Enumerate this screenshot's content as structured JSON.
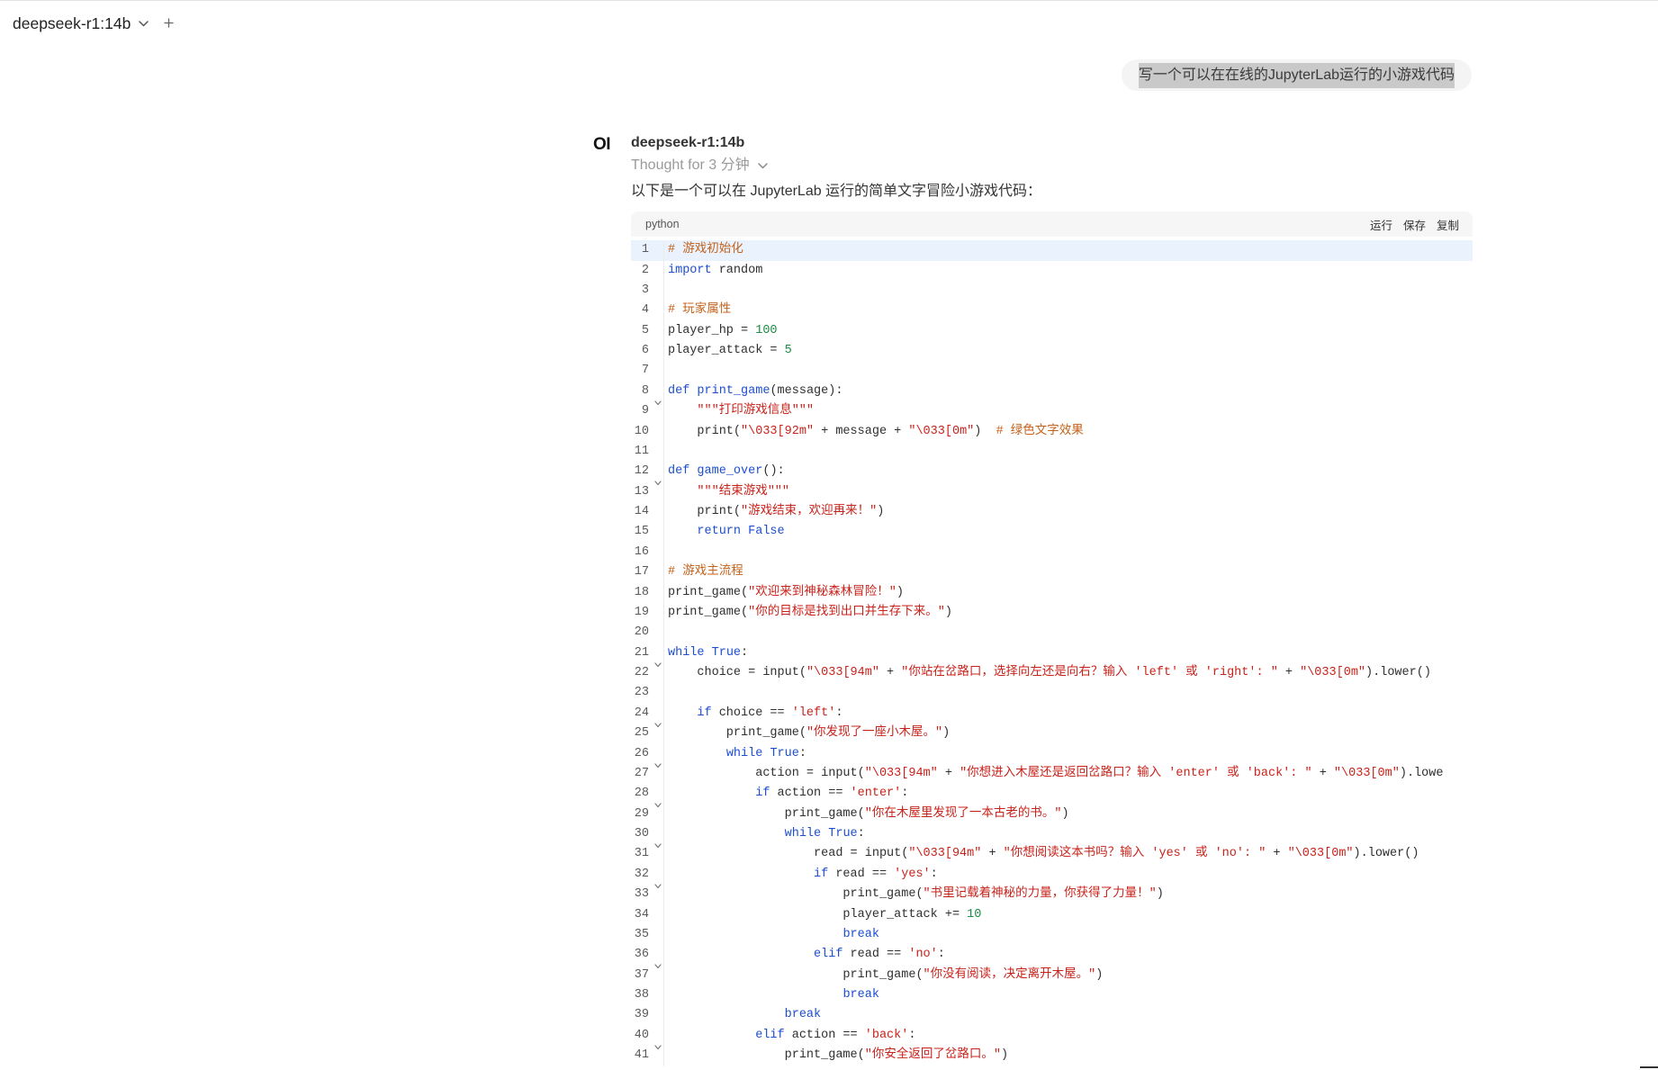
{
  "top_bar": {
    "model_name": "deepseek-r1:14b"
  },
  "user_message": {
    "text": "写一个可以在在线的JupyterLab运行的小游戏代码"
  },
  "assistant": {
    "avatar_text": "OI",
    "model_name": "deepseek-r1:14b",
    "thought_label": "Thought for 3 分钟",
    "intro": "以下是一个可以在 JupyterLab 运行的简单文字冒险小游戏代码："
  },
  "icons": {
    "model_dropdown": "chevron-down-icon",
    "add_model": "plus-icon",
    "thought_toggle": "chevron-down-icon",
    "fold": "chevron-down-icon"
  },
  "syntax_colors": {
    "plain": "#2f2f2f",
    "keyword": "#1d4ed0",
    "comment": "#c4621c",
    "string": "#c8231b",
    "number": "#1f8a45",
    "function": "#1d4ed0"
  },
  "code_block": {
    "language": "python",
    "actions": {
      "run": "运行",
      "save": "保存",
      "copy": "复制"
    },
    "active_line": 1,
    "lines": [
      {
        "num": "1",
        "tokens": [
          {
            "c": "# 游戏初始化"
          }
        ]
      },
      {
        "num": "2",
        "tokens": [
          {
            "k": "import"
          },
          {
            "p": " random"
          }
        ]
      },
      {
        "num": "3",
        "tokens": []
      },
      {
        "num": "4",
        "tokens": [
          {
            "c": "# 玩家属性"
          }
        ]
      },
      {
        "num": "5",
        "tokens": [
          {
            "p": "player_hp = "
          },
          {
            "d": "100"
          }
        ]
      },
      {
        "num": "6",
        "tokens": [
          {
            "p": "player_attack = "
          },
          {
            "d": "5"
          }
        ]
      },
      {
        "num": "7",
        "tokens": []
      },
      {
        "num": "8",
        "fold": true,
        "tokens": [
          {
            "k": "def"
          },
          {
            "p": " "
          },
          {
            "f": "print_game"
          },
          {
            "p": "(message):"
          }
        ]
      },
      {
        "num": "9",
        "tokens": [
          {
            "p": "    "
          },
          {
            "s": "\"\"\"打印游戏信息\"\"\""
          }
        ]
      },
      {
        "num": "10",
        "tokens": [
          {
            "p": "    print("
          },
          {
            "s": "\"\\033[92m\""
          },
          {
            "p": " + message + "
          },
          {
            "s": "\"\\033[0m\""
          },
          {
            "p": ")  "
          },
          {
            "c": "# 绿色文字效果"
          }
        ]
      },
      {
        "num": "11",
        "tokens": []
      },
      {
        "num": "12",
        "fold": true,
        "tokens": [
          {
            "k": "def"
          },
          {
            "p": " "
          },
          {
            "f": "game_over"
          },
          {
            "p": "():"
          }
        ]
      },
      {
        "num": "13",
        "tokens": [
          {
            "p": "    "
          },
          {
            "s": "\"\"\"结束游戏\"\"\""
          }
        ]
      },
      {
        "num": "14",
        "tokens": [
          {
            "p": "    print("
          },
          {
            "s": "\"游戏结束，欢迎再来！\""
          },
          {
            "p": ")"
          }
        ]
      },
      {
        "num": "15",
        "tokens": [
          {
            "p": "    "
          },
          {
            "k": "return"
          },
          {
            "p": " "
          },
          {
            "k": "False"
          }
        ]
      },
      {
        "num": "16",
        "tokens": []
      },
      {
        "num": "17",
        "tokens": [
          {
            "c": "# 游戏主流程"
          }
        ]
      },
      {
        "num": "18",
        "tokens": [
          {
            "p": "print_game("
          },
          {
            "s": "\"欢迎来到神秘森林冒险！\""
          },
          {
            "p": ")"
          }
        ]
      },
      {
        "num": "19",
        "tokens": [
          {
            "p": "print_game("
          },
          {
            "s": "\"你的目标是找到出口并生存下来。\""
          },
          {
            "p": ")"
          }
        ]
      },
      {
        "num": "20",
        "tokens": []
      },
      {
        "num": "21",
        "fold": true,
        "tokens": [
          {
            "k": "while"
          },
          {
            "p": " "
          },
          {
            "k": "True"
          },
          {
            "p": ":"
          }
        ]
      },
      {
        "num": "22",
        "tokens": [
          {
            "p": "    choice = input("
          },
          {
            "s": "\"\\033[94m\""
          },
          {
            "p": " + "
          },
          {
            "s": "\"你站在岔路口，选择向左还是向右？输入 'left' 或 'right': \""
          },
          {
            "p": " + "
          },
          {
            "s": "\"\\033[0m\""
          },
          {
            "p": ").lower()"
          }
        ]
      },
      {
        "num": "23",
        "tokens": []
      },
      {
        "num": "24",
        "fold": true,
        "tokens": [
          {
            "p": "    "
          },
          {
            "k": "if"
          },
          {
            "p": " choice == "
          },
          {
            "s": "'left'"
          },
          {
            "p": ":"
          }
        ]
      },
      {
        "num": "25",
        "tokens": [
          {
            "p": "        print_game("
          },
          {
            "s": "\"你发现了一座小木屋。\""
          },
          {
            "p": ")"
          }
        ]
      },
      {
        "num": "26",
        "fold": true,
        "tokens": [
          {
            "p": "        "
          },
          {
            "k": "while"
          },
          {
            "p": " "
          },
          {
            "k": "True"
          },
          {
            "p": ":"
          }
        ]
      },
      {
        "num": "27",
        "tokens": [
          {
            "p": "            action = input("
          },
          {
            "s": "\"\\033[94m\""
          },
          {
            "p": " + "
          },
          {
            "s": "\"你想进入木屋还是返回岔路口？输入 'enter' 或 'back': \""
          },
          {
            "p": " + "
          },
          {
            "s": "\"\\033[0m\""
          },
          {
            "p": ").lowe"
          }
        ]
      },
      {
        "num": "28",
        "fold": true,
        "tokens": [
          {
            "p": "            "
          },
          {
            "k": "if"
          },
          {
            "p": " action == "
          },
          {
            "s": "'enter'"
          },
          {
            "p": ":"
          }
        ]
      },
      {
        "num": "29",
        "tokens": [
          {
            "p": "                print_game("
          },
          {
            "s": "\"你在木屋里发现了一本古老的书。\""
          },
          {
            "p": ")"
          }
        ]
      },
      {
        "num": "30",
        "fold": true,
        "tokens": [
          {
            "p": "                "
          },
          {
            "k": "while"
          },
          {
            "p": " "
          },
          {
            "k": "True"
          },
          {
            "p": ":"
          }
        ]
      },
      {
        "num": "31",
        "tokens": [
          {
            "p": "                    read = input("
          },
          {
            "s": "\"\\033[94m\""
          },
          {
            "p": " + "
          },
          {
            "s": "\"你想阅读这本书吗？输入 'yes' 或 'no': \""
          },
          {
            "p": " + "
          },
          {
            "s": "\"\\033[0m\""
          },
          {
            "p": ").lower()"
          }
        ]
      },
      {
        "num": "32",
        "fold": true,
        "tokens": [
          {
            "p": "                    "
          },
          {
            "k": "if"
          },
          {
            "p": " read == "
          },
          {
            "s": "'yes'"
          },
          {
            "p": ":"
          }
        ]
      },
      {
        "num": "33",
        "tokens": [
          {
            "p": "                        print_game("
          },
          {
            "s": "\"书里记载着神秘的力量，你获得了力量！\""
          },
          {
            "p": ")"
          }
        ]
      },
      {
        "num": "34",
        "tokens": [
          {
            "p": "                        player_attack += "
          },
          {
            "d": "10"
          }
        ]
      },
      {
        "num": "35",
        "tokens": [
          {
            "p": "                        "
          },
          {
            "k": "break"
          }
        ]
      },
      {
        "num": "36",
        "fold": true,
        "tokens": [
          {
            "p": "                    "
          },
          {
            "k": "elif"
          },
          {
            "p": " read == "
          },
          {
            "s": "'no'"
          },
          {
            "p": ":"
          }
        ]
      },
      {
        "num": "37",
        "tokens": [
          {
            "p": "                        print_game("
          },
          {
            "s": "\"你没有阅读，决定离开木屋。\""
          },
          {
            "p": ")"
          }
        ]
      },
      {
        "num": "38",
        "tokens": [
          {
            "p": "                        "
          },
          {
            "k": "break"
          }
        ]
      },
      {
        "num": "39",
        "tokens": [
          {
            "p": "                "
          },
          {
            "k": "break"
          }
        ]
      },
      {
        "num": "40",
        "fold": true,
        "tokens": [
          {
            "p": "            "
          },
          {
            "k": "elif"
          },
          {
            "p": " action == "
          },
          {
            "s": "'back'"
          },
          {
            "p": ":"
          }
        ]
      },
      {
        "num": "41",
        "tokens": [
          {
            "p": "                print_game("
          },
          {
            "s": "\"你安全返回了岔路口。\""
          },
          {
            "p": ")"
          }
        ]
      }
    ]
  }
}
